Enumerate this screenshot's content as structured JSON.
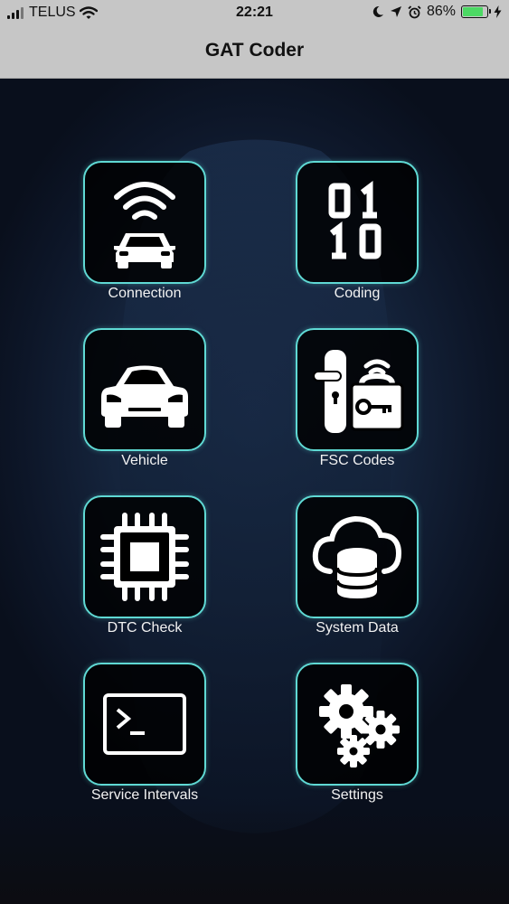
{
  "status_bar": {
    "carrier": "TELUS",
    "time": "22:21",
    "battery_percent": "86%",
    "battery_level": 0.86
  },
  "nav": {
    "title": "GAT Coder"
  },
  "menu": [
    {
      "label": "Connection",
      "icon": "car-wifi-icon"
    },
    {
      "label": "Coding",
      "icon": "binary-icon"
    },
    {
      "label": "Vehicle",
      "icon": "car-icon"
    },
    {
      "label": "FSC Codes",
      "icon": "key-lock-icon"
    },
    {
      "label": "DTC Check",
      "icon": "chip-icon"
    },
    {
      "label": "System Data",
      "icon": "cloud-database-icon"
    },
    {
      "label": "Service Intervals",
      "icon": "terminal-icon"
    },
    {
      "label": "Settings",
      "icon": "gears-icon"
    }
  ],
  "colors": {
    "accent": "#5fd9d4",
    "bar_background": "#c6c6c6",
    "battery_fill": "#4cd964"
  }
}
